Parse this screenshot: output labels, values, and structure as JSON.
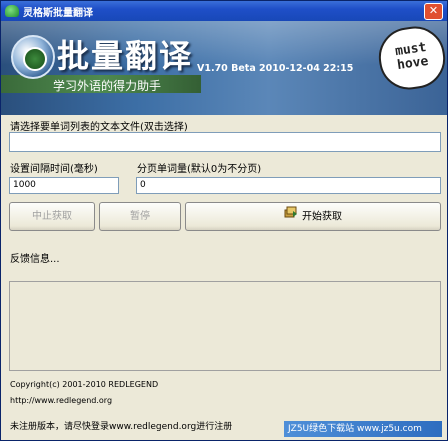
{
  "window": {
    "title": "灵格斯批量翻译",
    "close_glyph": "✕"
  },
  "banner": {
    "title": "批量翻译",
    "version": "V1.70 Beta 2010-12-04 22:15",
    "slogan": "学习外语的得力助手",
    "badge_text": "must hove"
  },
  "file_section": {
    "label": "请选择要单词列表的文本文件(双击选择)",
    "value": ""
  },
  "interval": {
    "label": "设置间隔时间(毫秒)",
    "value": "1000"
  },
  "page_size": {
    "label": "分页单词量(默认0为不分页)",
    "value": "0"
  },
  "buttons": {
    "stop": "中止获取",
    "pause": "暂停",
    "start": "开始获取"
  },
  "log": {
    "label": "反馈信息..."
  },
  "footer": {
    "copyright": "Copyright(c) 2001-2010 REDLEGEND",
    "url": "http://www.redlegend.org",
    "notice": "未注册版本，请尽快登录www.redlegend.org进行注册",
    "watermark": "JZ5U绿色下载站 www.jz5u.com"
  }
}
